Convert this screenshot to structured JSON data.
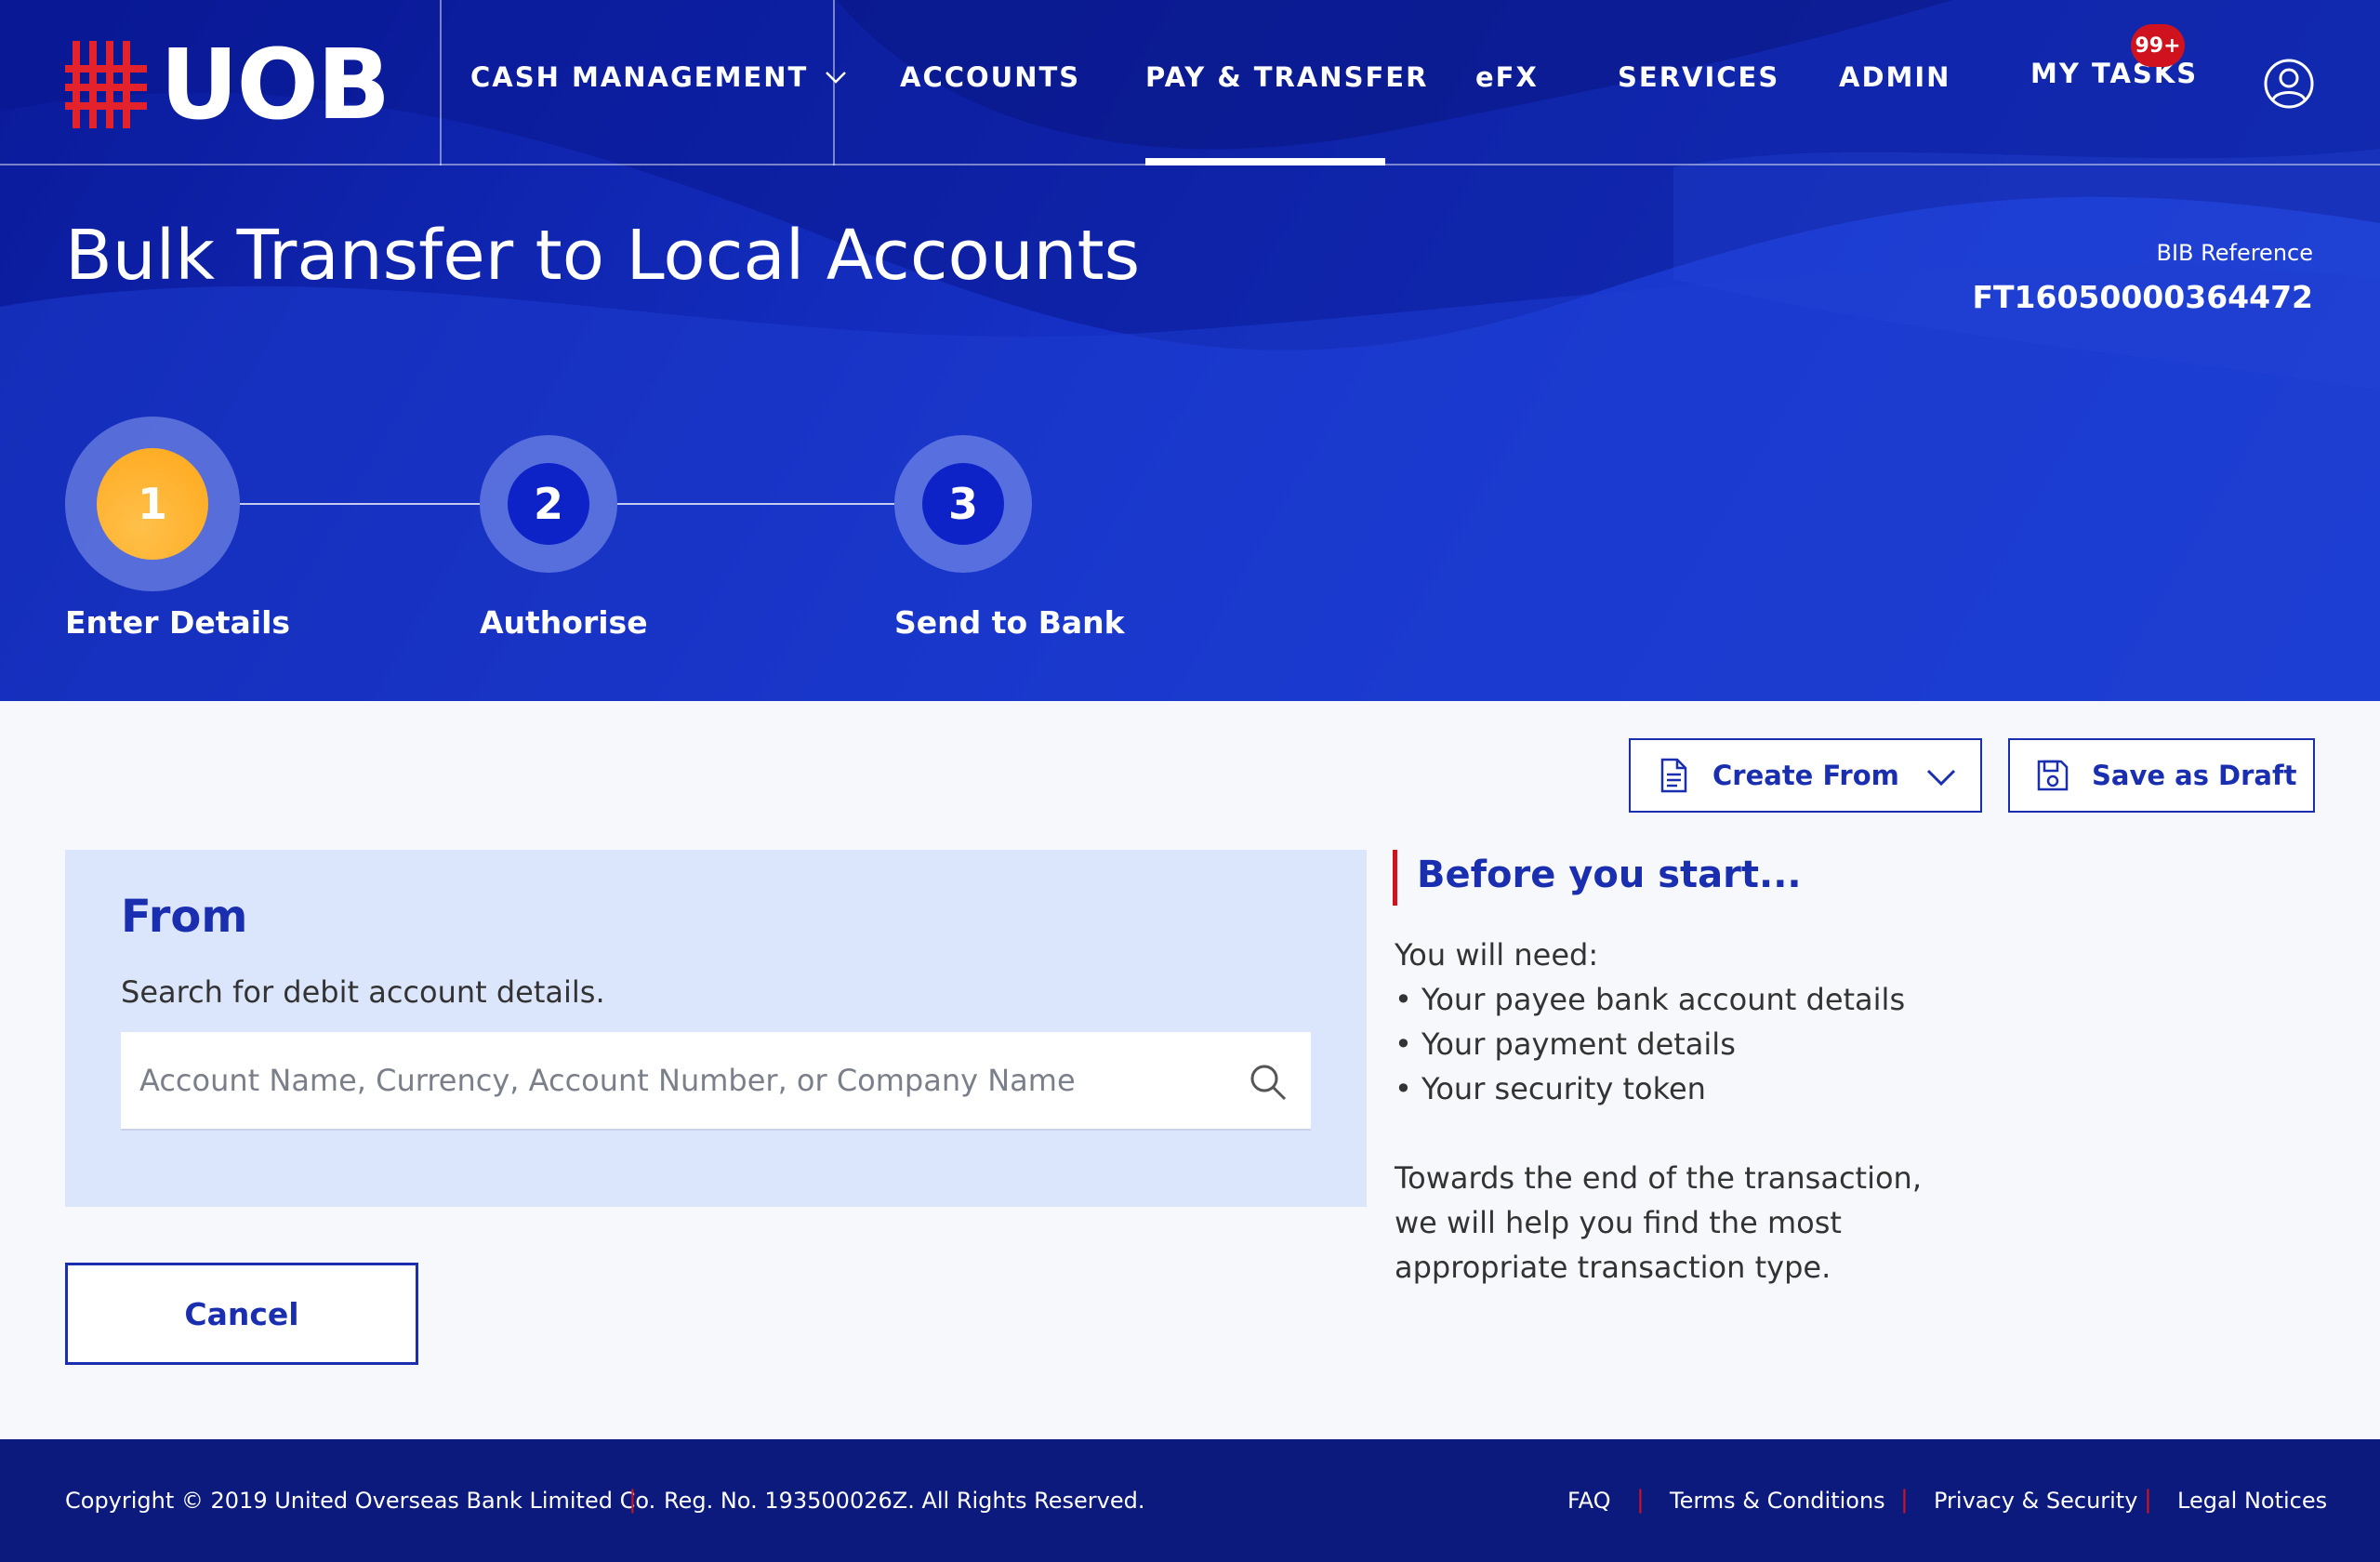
{
  "brand": {
    "name": "UOB",
    "accent": "#d0121f",
    "primary": "#1a2fb0"
  },
  "nav": {
    "cash_management": "CASH MANAGEMENT",
    "accounts": "ACCOUNTS",
    "pay_transfer": "PAY & TRANSFER",
    "efx": "eFX",
    "services": "SERVICES",
    "admin": "ADMIN",
    "my_tasks": "MY TASKS",
    "tasks_badge": "99+",
    "active": "PAY & TRANSFER"
  },
  "page": {
    "title": "Bulk Transfer to Local Accounts",
    "bib_label": "BIB Reference",
    "bib_value": "FT16050000364472"
  },
  "stepper": {
    "steps": [
      {
        "number": "1",
        "label": "Enter Details",
        "state": "active"
      },
      {
        "number": "2",
        "label": "Authorise",
        "state": "pending"
      },
      {
        "number": "3",
        "label": "Send to Bank",
        "state": "pending"
      }
    ]
  },
  "actions": {
    "create_from": "Create From",
    "save_draft": "Save as Draft"
  },
  "from": {
    "title": "From",
    "subtitle": "Search for debit account details.",
    "search_placeholder": "Account Name, Currency, Account Number, or Company Name",
    "search_value": ""
  },
  "cancel_label": "Cancel",
  "before_you_start": {
    "title": "Before you start...",
    "need": "You will need:",
    "items": [
      "• Your payee bank account details",
      "• Your payment details",
      "• Your security token"
    ],
    "closing": [
      "Towards the end of the transaction,",
      "we will help you find the most",
      "appropriate transaction type."
    ]
  },
  "footer": {
    "copyright": "Copyright © 2019 United Overseas Bank Limited Co.",
    "reg": "Reg. No. 193500026Z. All Rights Reserved.",
    "links": [
      "FAQ",
      "Terms & Conditions",
      "Privacy & Security",
      "Legal Notices"
    ],
    "separator": "|"
  }
}
